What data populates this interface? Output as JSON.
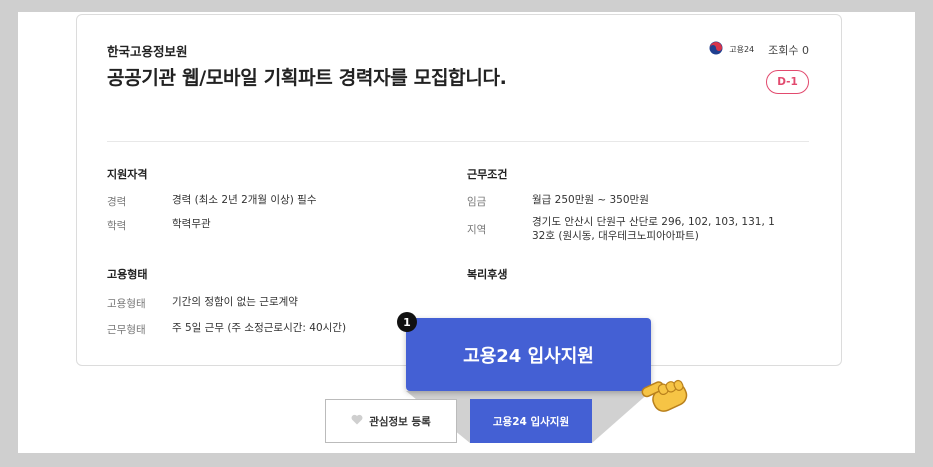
{
  "job": {
    "organization": "한국고용정보원",
    "title": "공공기관 웹/모바일 기획파트 경력자를 모집합니다.",
    "brand_label": "고용24",
    "views_label": "조회수 0",
    "dday": "D-1"
  },
  "qualification": {
    "heading": "지원자격",
    "rows": [
      {
        "label": "경력",
        "value": "경력 (최소 2년 2개월 이상) 필수"
      },
      {
        "label": "학력",
        "value": "학력무관"
      }
    ]
  },
  "conditions": {
    "heading": "근무조건",
    "rows": [
      {
        "label": "임금",
        "value": "월급 250만원 ~ 350만원"
      },
      {
        "label": "지역",
        "value": "경기도 안산시 단원구 산단로 296, 102, 103, 131, 1",
        "value2": "32호 (원시동, 대우테크노피아아파트)"
      }
    ]
  },
  "employment": {
    "heading": "고용형태",
    "rows": [
      {
        "label": "고용형태",
        "value": "기간의 정함이 없는 근로계약"
      },
      {
        "label": "근무형태",
        "value": "주 5일 근무 (주 소정근로시간: 40시간)"
      }
    ]
  },
  "welfare": {
    "heading": "복리후생"
  },
  "callout": {
    "step": "1",
    "label": "고용24 입사지원"
  },
  "actions": {
    "favorite_label": "관심정보 등록",
    "apply_label": "고용24 입사지원"
  },
  "colors": {
    "accent": "#4460d4",
    "dday": "#e24a6e"
  }
}
